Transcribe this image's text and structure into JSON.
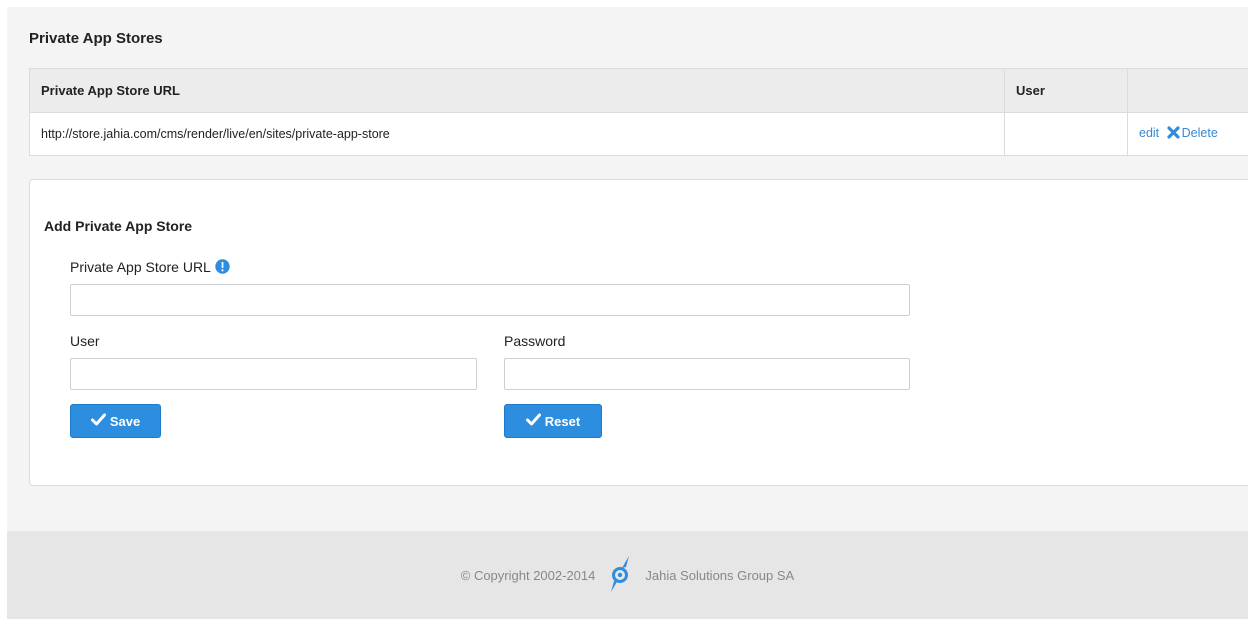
{
  "section": {
    "title": "Private App Stores"
  },
  "table": {
    "headers": [
      "Private App Store URL",
      "User",
      ""
    ],
    "rows": [
      {
        "url": "http://store.jahia.com/cms/render/live/en/sites/private-app-store",
        "user": "",
        "edit_label": "edit",
        "delete_label": "Delete"
      }
    ]
  },
  "form": {
    "title": "Add Private App Store",
    "url_label": "Private App Store URL",
    "url_value": "",
    "user_label": "User",
    "user_value": "",
    "password_label": "Password",
    "password_value": "",
    "save_label": "Save",
    "reset_label": "Reset"
  },
  "footer": {
    "copyright": "© Copyright 2002-2014",
    "company": "Jahia Solutions Group SA"
  },
  "colors": {
    "accent": "#2d8ee0",
    "link": "#3a87d6",
    "logo": "#2d8ee0"
  },
  "icons": [
    "x-icon",
    "info-icon",
    "checkmark-icon",
    "jahia-logo-icon"
  ]
}
